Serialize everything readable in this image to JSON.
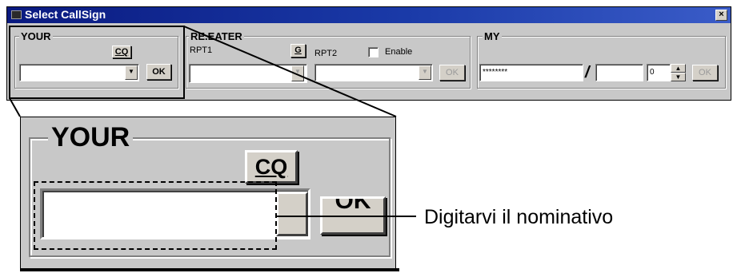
{
  "window": {
    "title": "Select CallSign",
    "close_glyph": "×"
  },
  "your": {
    "label": "YOUR",
    "cq_label": "CQ",
    "ok_label": "OK",
    "value": ""
  },
  "repeater": {
    "label": "REPEATER",
    "label_visible": "RE.EATER",
    "g_label": "G",
    "rpt1_label": "RPT1",
    "rpt2_label": "RPT2",
    "enable_label": "Enable",
    "ok_label": "OK"
  },
  "my": {
    "label": "MY",
    "callsign_value": "********",
    "separator": "/",
    "suffix_value": "",
    "number_value": "0",
    "ok_label": "OK"
  },
  "zoom": {
    "label": "YOUR",
    "cq_label": "CQ",
    "ok_label_partial": "OK"
  },
  "annotation": {
    "text": "Digitarvi il nominativo"
  },
  "colors": {
    "title_bar": "#0a1a80",
    "window_bg": "#c8c8c8"
  }
}
